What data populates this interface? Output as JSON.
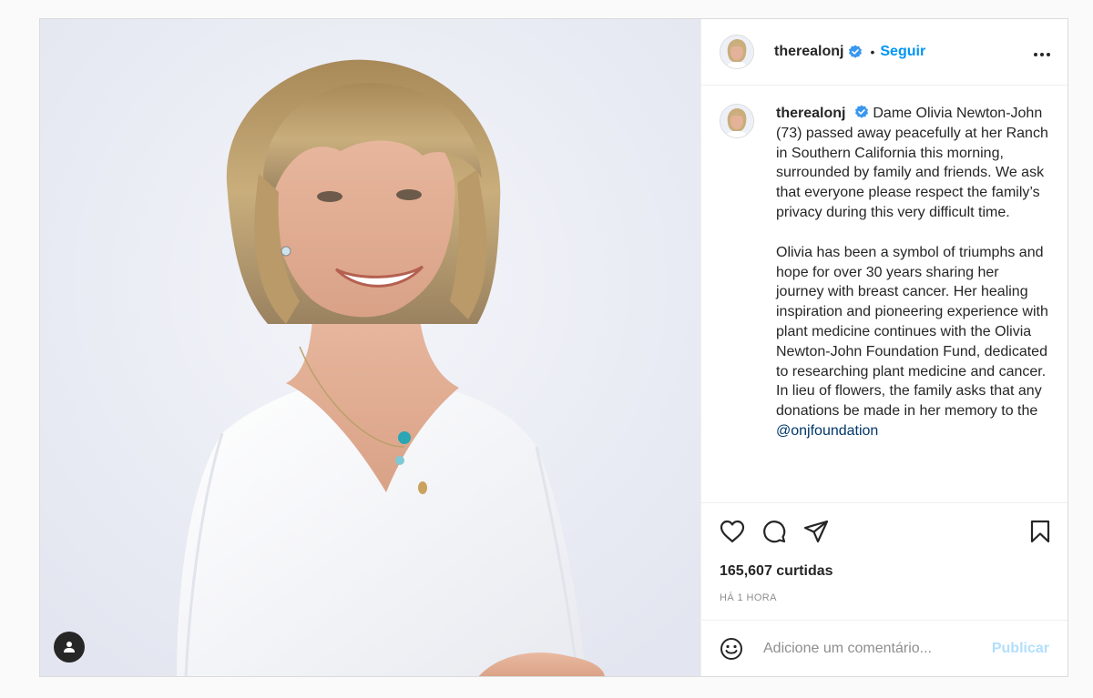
{
  "header": {
    "username": "therealonj",
    "separator": "•",
    "follow_label": "Seguir",
    "more_label": "•••"
  },
  "caption": {
    "username": "therealonj",
    "paragraph1": "Dame Olivia Newton-John (73) passed away peacefully at her Ranch in Southern California this morning, surrounded by family and friends. We ask that everyone please respect the family’s privacy during this very difficult time.",
    "paragraph2": "Olivia has been a symbol of triumphs and hope for over 30 years sharing her journey with breast cancer. Her healing inspiration and pioneering experience with plant medicine continues with the Olivia Newton-John Foundation Fund, dedicated to researching plant medicine and cancer. In lieu of flowers, the family asks that any donations be made in her memory to the",
    "mention": "@onjfoundation"
  },
  "actions": {
    "icons": [
      "heart-icon",
      "comment-icon",
      "share-icon",
      "bookmark-icon"
    ]
  },
  "likes": "165,607 curtidas",
  "timestamp": "HÁ 1 HORA",
  "comment": {
    "placeholder": "Adicione um comentário...",
    "publish_label": "Publicar"
  },
  "colors": {
    "accent": "#0095f6",
    "verified": "#3897f0",
    "mention": "#00376b",
    "publish_disabled": "#b2dffc"
  }
}
